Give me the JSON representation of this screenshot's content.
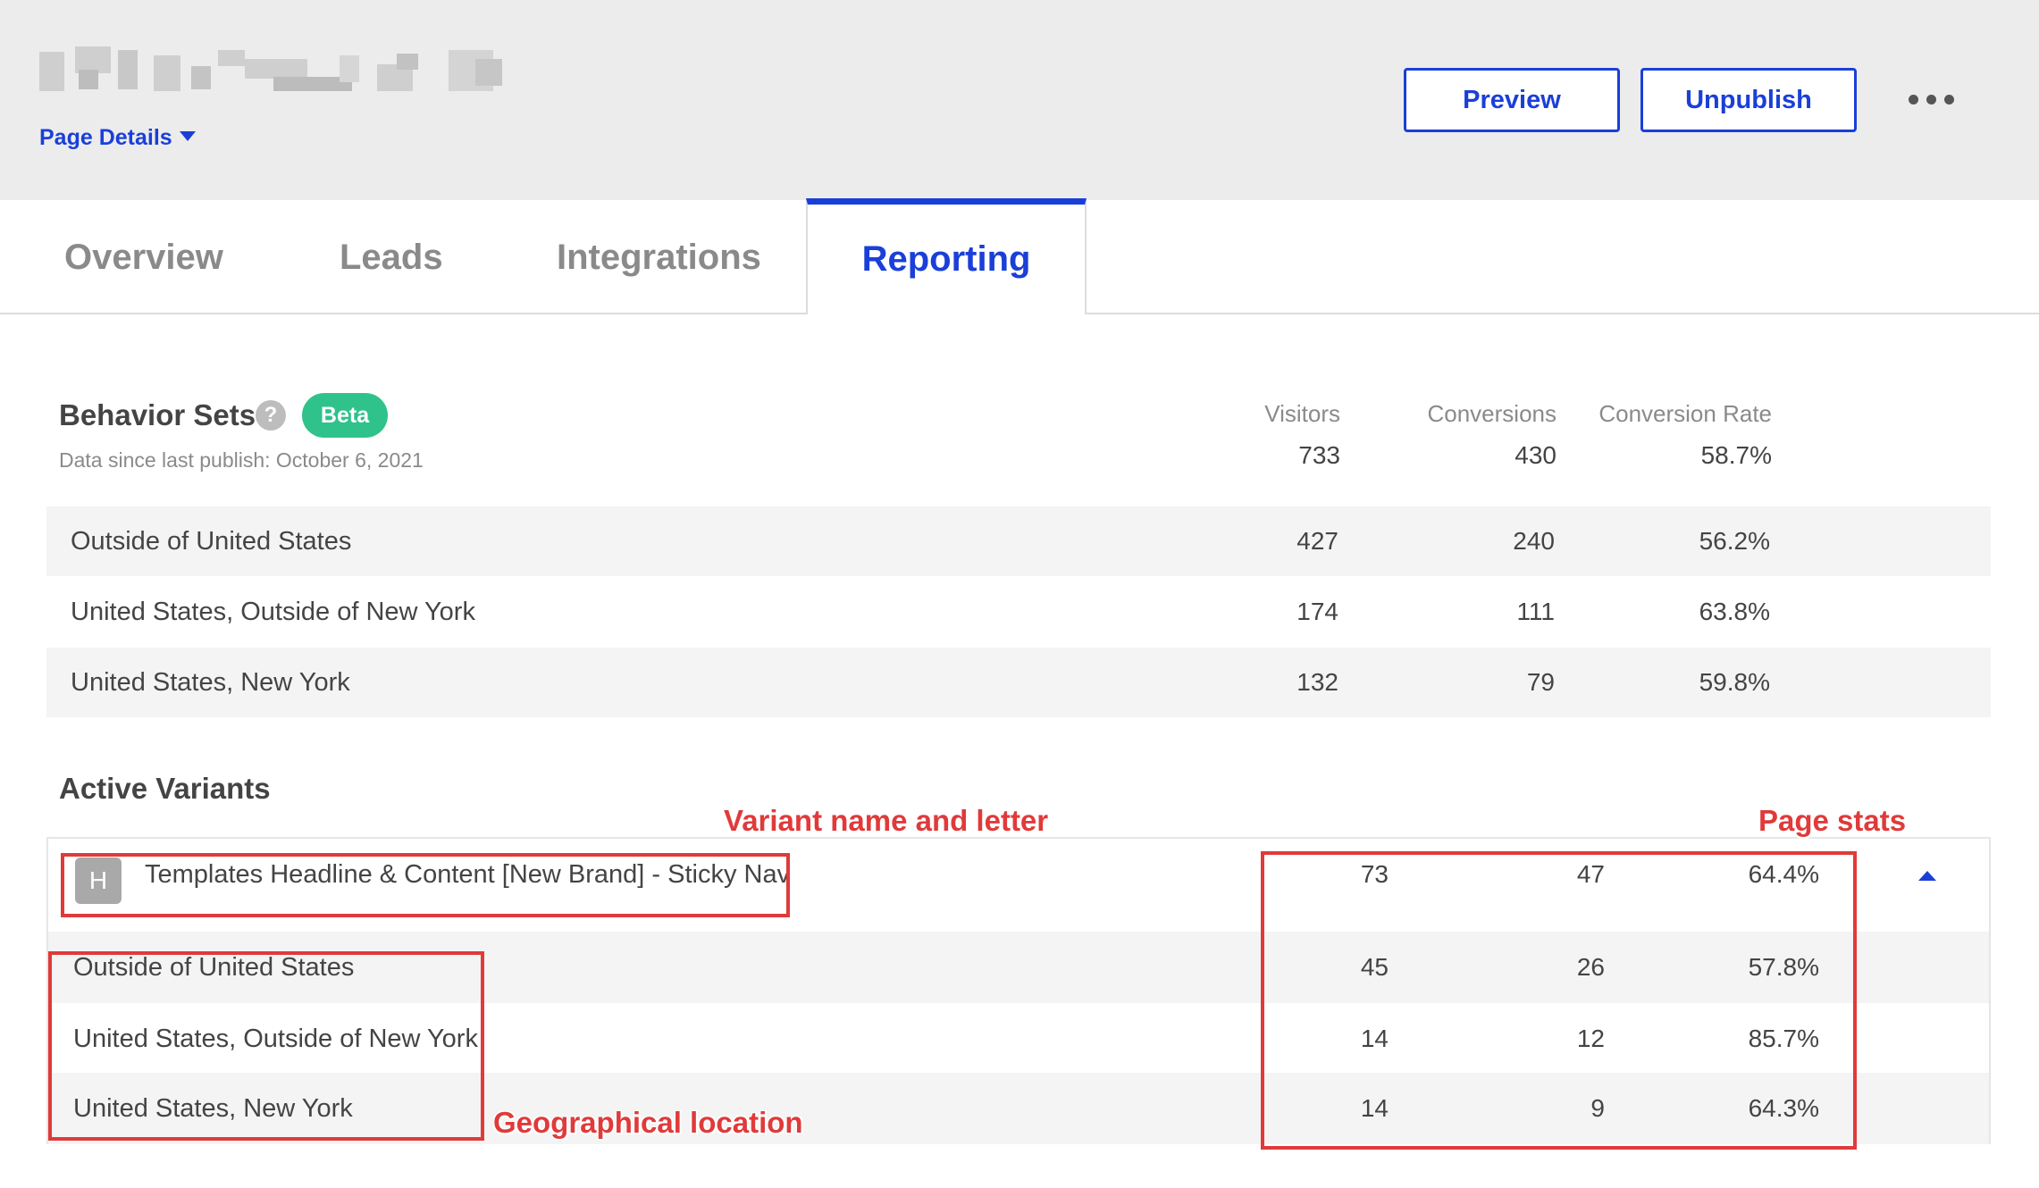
{
  "header": {
    "page_details_label": "Page Details",
    "preview_label": "Preview",
    "unpublish_label": "Unpublish",
    "more_icon": "more-horizontal-icon"
  },
  "tabs": [
    {
      "label": "Overview"
    },
    {
      "label": "Leads"
    },
    {
      "label": "Integrations"
    },
    {
      "label": "Reporting",
      "active": true
    }
  ],
  "columns": {
    "visitors": "Visitors",
    "conversions": "Conversions",
    "conversion_rate": "Conversion Rate"
  },
  "behavior_sets": {
    "title": "Behavior Sets",
    "help_icon_glyph": "?",
    "badge": "Beta",
    "since": "Data since last publish: October 6, 2021",
    "totals": {
      "visitors": "733",
      "conversions": "430",
      "rate": "58.7%"
    },
    "rows": [
      {
        "label": "Outside of United States",
        "visitors": "427",
        "conversions": "240",
        "rate": "56.2%"
      },
      {
        "label": "United States, Outside of New York",
        "visitors": "174",
        "conversions": "111",
        "rate": "63.8%"
      },
      {
        "label": "United States, New York",
        "visitors": "132",
        "conversions": "79",
        "rate": "59.8%"
      }
    ]
  },
  "active_variants": {
    "title": "Active Variants",
    "variant": {
      "letter": "H",
      "name": "Templates Headline & Content [New Brand] - Sticky Nav",
      "visitors": "73",
      "conversions": "47",
      "rate": "64.4%"
    },
    "rows": [
      {
        "label": "Outside of United States",
        "visitors": "45",
        "conversions": "26",
        "rate": "57.8%"
      },
      {
        "label": "United States, Outside of New York",
        "visitors": "14",
        "conversions": "12",
        "rate": "85.7%"
      },
      {
        "label": "United States, New York",
        "visitors": "14",
        "conversions": "9",
        "rate": "64.3%"
      }
    ]
  },
  "annotations": {
    "variant": "Variant name and letter",
    "stats": "Page stats",
    "geo": "Geographical location"
  },
  "colors": {
    "accent": "#1a3fd9",
    "beta": "#2fc28b",
    "annotation": "#e03a3a"
  }
}
